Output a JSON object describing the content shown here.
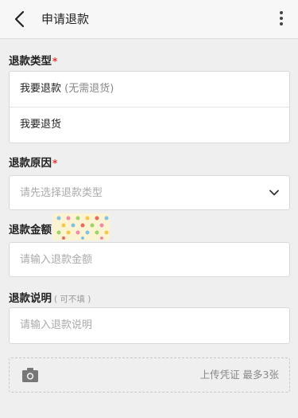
{
  "header": {
    "title": "申请退款"
  },
  "refund_type": {
    "label": "退款类型",
    "required_mark": "*",
    "options": [
      {
        "label": "我要退款",
        "note": "(无需退货)"
      },
      {
        "label": "我要退货"
      }
    ]
  },
  "refund_reason": {
    "label": "退款原因",
    "required_mark": "*",
    "placeholder": "请先选择退款类型"
  },
  "refund_amount": {
    "label": "退款金额",
    "placeholder": "请输入退款金额"
  },
  "refund_note": {
    "label": "退款说明",
    "hint": "( 可不填 )",
    "placeholder": "请输入退款说明"
  },
  "upload": {
    "label": "上传凭证 最多3张"
  },
  "colors": {
    "required": "#e5372f",
    "page_bg": "#efefef",
    "card_bg": "#ffffff"
  }
}
